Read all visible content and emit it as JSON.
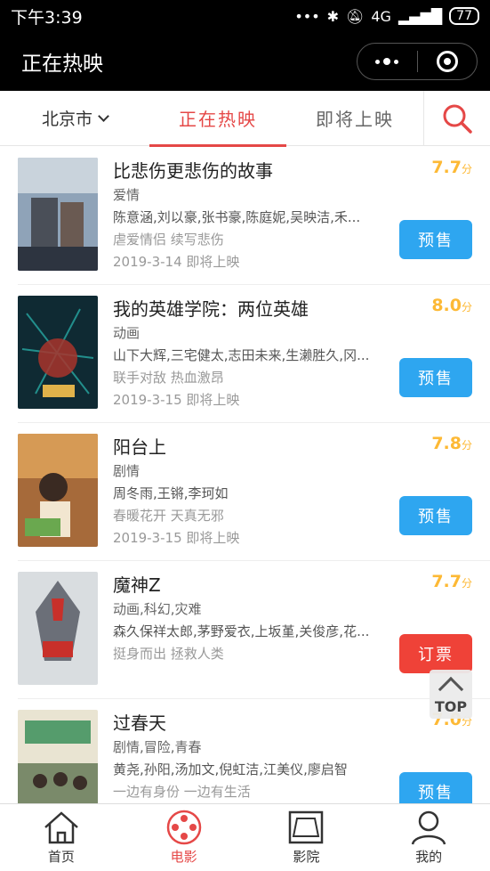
{
  "status_bar": {
    "time": "下午3:39",
    "signal": "4G",
    "battery": "77"
  },
  "title_bar": {
    "title": "正在热映"
  },
  "tabs": {
    "city": "北京市",
    "now_showing": "正在热映",
    "coming_soon": "即将上映"
  },
  "movies": [
    {
      "title": "比悲伤更悲伤的故事",
      "score": "7.7",
      "score_unit": "分",
      "genre": "爱情",
      "cast": "陈意涵,刘以豪,张书豪,陈庭妮,吴映洁,禾...",
      "tagline": "虐爱情侣 续写悲伤",
      "release": "2019-3-14 即将上映",
      "button": "预售",
      "button_color": "#2ea6f0"
    },
    {
      "title": "我的英雄学院：两位英雄",
      "score": "8.0",
      "score_unit": "分",
      "genre": "动画",
      "cast": "山下大辉,三宅健太,志田未来,生濑胜久,冈...",
      "tagline": "联手对敌 热血激昂",
      "release": "2019-3-15 即将上映",
      "button": "预售",
      "button_color": "#2ea6f0"
    },
    {
      "title": "阳台上",
      "score": "7.8",
      "score_unit": "分",
      "genre": "剧情",
      "cast": "周冬雨,王锵,李珂如",
      "tagline": "春暖花开 天真无邪",
      "release": "2019-3-15 即将上映",
      "button": "预售",
      "button_color": "#2ea6f0"
    },
    {
      "title": "魔神Z",
      "score": "7.7",
      "score_unit": "分",
      "genre": "动画,科幻,灾难",
      "cast": "森久保祥太郎,茅野爱衣,上坂堇,关俊彦,花...",
      "tagline": "挺身而出 拯救人类",
      "release": "",
      "button": "订票",
      "button_color": "#ef4238"
    },
    {
      "title": "过春天",
      "score": "7.0",
      "score_unit": "分",
      "genre": "剧情,冒险,青春",
      "cast": "黄尧,孙阳,汤加文,倪虹洁,江美仪,廖启智",
      "tagline": "一边有身份 一边有生活",
      "release": "",
      "button": "预售",
      "button_color": "#2ea6f0"
    }
  ],
  "top_button": "TOP",
  "bottom_nav": [
    {
      "label": "首页",
      "icon": "home-icon"
    },
    {
      "label": "电影",
      "icon": "film-reel-icon"
    },
    {
      "label": "影院",
      "icon": "cinema-icon"
    },
    {
      "label": "我的",
      "icon": "user-icon"
    }
  ],
  "colors": {
    "accent": "#e54847",
    "presale": "#2ea6f0",
    "ticket": "#ef4238",
    "score": "#fdb935"
  }
}
